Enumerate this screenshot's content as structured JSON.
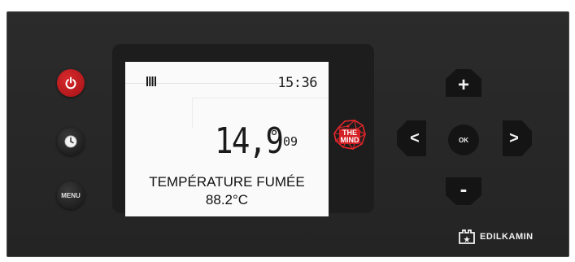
{
  "panel": {
    "buttons": {
      "menu_label": "MENU",
      "ok_label": "OK",
      "up_label": "+",
      "down_label": "-",
      "left_label": "<",
      "right_label": ">"
    },
    "display": {
      "time": "15:36",
      "temperature": "14,9",
      "degree_symbol": "°",
      "unit_code": "09",
      "mode_text": "TEMPÉRATURE FUMÉE",
      "value_text": "88.2°C"
    },
    "logos": {
      "mind_line1": "THE",
      "mind_line2": "MIND",
      "brand": "EDILKAMIN"
    },
    "icons": {
      "power": "power-icon",
      "clock": "clock-icon",
      "heater": "heater-icon",
      "brand": "edilkamin-logo-icon"
    },
    "colors": {
      "panel": "#262626",
      "power": "#c41e22",
      "lcd": "#fafafa",
      "mind": "#e3262a"
    }
  }
}
